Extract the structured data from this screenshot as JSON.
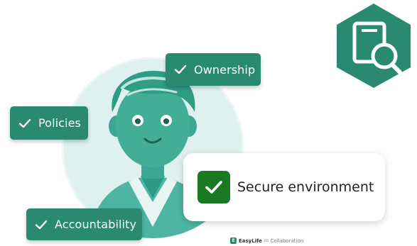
{
  "colors": {
    "pill": "#2a8a70",
    "secure_check": "#1a7a24",
    "hexagon": "#2a8a70",
    "avatar_bg": "#dff1ee",
    "avatar_main": "#3aa894"
  },
  "pills": {
    "ownership": "Ownership",
    "policies": "Policies",
    "accountability": "Accountability"
  },
  "card": {
    "label": "Secure environment"
  },
  "footer": {
    "brand": "EasyLife",
    "sup": "365",
    "product": "Collaboration"
  },
  "icons": {
    "check": "check-icon",
    "badge": "document-search-icon",
    "avatar": "person-avatar-icon"
  }
}
